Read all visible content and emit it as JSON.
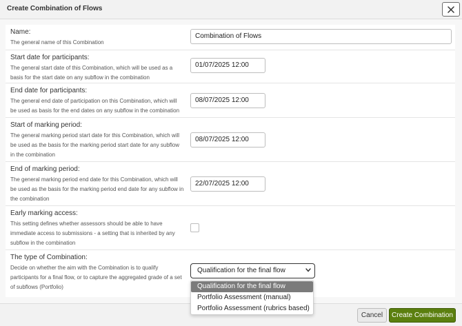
{
  "dialog": {
    "title": "Create Combination of Flows"
  },
  "fields": {
    "name": {
      "label": "Name:",
      "description": "The general name of this Combination",
      "value": "Combination of Flows"
    },
    "start_participants": {
      "label": "Start date for participants:",
      "description": "The general start date of this Combination, which will be used as a basis for the start date on any subflow in the combination",
      "value": "01/07/2025 12:00"
    },
    "end_participants": {
      "label": "End date for participants:",
      "description": "The general end date of participation on this Combination, which will be used as basis for the end dates on any subflow in the combination",
      "value": "08/07/2025 12:00"
    },
    "start_marking": {
      "label": "Start of marking period:",
      "description": "The general marking period start date for this Combination, which will be used as the basis for the marking period start date for any subflow in the combination",
      "value": "08/07/2025 12:00"
    },
    "end_marking": {
      "label": "End of marking period:",
      "description": "The general marking period end date for this Combination, which will be used as the basis for the marking period end date for any subflow in the combination",
      "value": "22/07/2025 12:00"
    },
    "early_marking": {
      "label": "Early marking access:",
      "description": "This setting defines whether assessors should be able to have immediate access to submissions - a setting that is inherited by any subflow in the combination",
      "checked": false
    },
    "type": {
      "label": "The type of Combination:",
      "description": "Decide on whether the aim with the Combination is to qualify participants for a final flow, or to capture the aggregated grade of a set of subflows (Portfolio)",
      "selected": "Qualification for the final flow",
      "options": [
        "Qualification for the final flow",
        "Portfolio Assessment (manual)",
        "Portfolio Assessment (rubrics based)"
      ]
    }
  },
  "footer": {
    "cancel_label": "Cancel",
    "create_label": "Create Combination"
  },
  "colors": {
    "primary_button": "#5b7f0f",
    "selected_option": "#7b7b7b"
  }
}
